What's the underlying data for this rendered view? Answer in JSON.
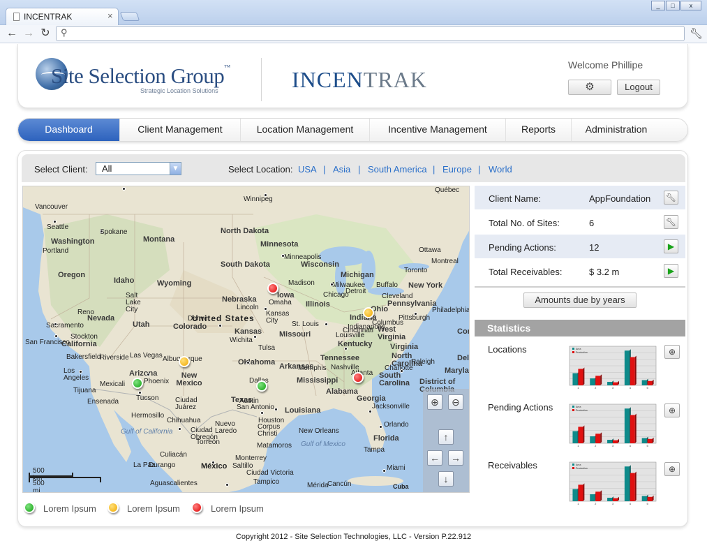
{
  "browser": {
    "tab_title": "INCENTRAK",
    "tab_close": "×",
    "address": "",
    "window_controls": [
      "_",
      "□",
      "x"
    ]
  },
  "header": {
    "brand_name": "Site Selection Group",
    "brand_tm": "™",
    "brand_tagline": "Strategic Location Solutions",
    "product_part1": "INCEN",
    "product_part2": "TRAK",
    "welcome": "Welcome Phillipe",
    "logout_label": "Logout",
    "settings_icon": "gear-icon"
  },
  "menu": {
    "items": [
      {
        "label": "Dashboard",
        "active": true
      },
      {
        "label": "Client Management"
      },
      {
        "label": "Location Management"
      },
      {
        "label": "Incentive Management"
      },
      {
        "label": "Reports"
      },
      {
        "label": "Administration"
      }
    ]
  },
  "filters": {
    "select_client_label": "Select Client:",
    "client_value": "All",
    "select_location_label": "Select Location:",
    "locations": [
      "USA",
      "Asia",
      "South America",
      "Europe",
      "World"
    ],
    "separator": "|"
  },
  "map": {
    "country_label": "United States",
    "scale_km": "500 km",
    "scale_mi": "500 mi",
    "credit": "Cuba",
    "states": [
      "Washington",
      "Oregon",
      "Idaho",
      "Montana",
      "North Dakota",
      "South Dakota",
      "Minnesota",
      "Wisconsin",
      "Michigan",
      "Wyoming",
      "Nevada",
      "Utah",
      "Colorado",
      "Nebraska",
      "Iowa",
      "Illinois",
      "Indiana",
      "Ohio",
      "Pennsylvania",
      "New York",
      "California",
      "Arizona",
      "New Mexico",
      "Texas",
      "Oklahoma",
      "Kansas",
      "Missouri",
      "Kentucky",
      "Tennessee",
      "Arkansas",
      "Mississippi",
      "Alabama",
      "Georgia",
      "Louisiana",
      "Florida",
      "Virginia",
      "West Virginia",
      "North Carolina",
      "South Carolina",
      "Maryland",
      "District of Columbia",
      "Conn",
      "Delaw"
    ],
    "cities": [
      "Vancouver",
      "Seattle",
      "Spokane",
      "Portland",
      "Winnipeg",
      "Minneapolis",
      "Salt Lake City",
      "Sacramento",
      "San Francisco",
      "Stockton",
      "Reno",
      "Bakersfield",
      "Los Angeles",
      "Las Vegas",
      "Riverside",
      "Mexicali",
      "Tijuana",
      "Ensenada",
      "Phoenix",
      "Tucson",
      "Albuquerque",
      "Denver",
      "Lincoln",
      "Omaha",
      "Kansas City",
      "Wichita",
      "Tulsa",
      "Dallas",
      "San Antonio",
      "Houston",
      "Austin",
      "Corpus Christi",
      "Monterrey",
      "Chihuahua",
      "Ciudad Juárez",
      "Hermosillo",
      "Culiacán",
      "La Paz",
      "Durango",
      "Torreón",
      "Saltillo",
      "Matamoros",
      "Nuevo Laredo",
      "Ciudad Obregón",
      "Ciudad Victoria",
      "Tampico",
      "Aguascalientes",
      "Mérida",
      "Cancún",
      "Chicago",
      "Madison",
      "Milwaukee",
      "Detroit",
      "Cleveland",
      "Toronto",
      "Buffalo",
      "Montreal",
      "Ottawa",
      "Québec",
      "Columbus",
      "Cincinnati",
      "Louisville",
      "Nashville",
      "Memphis",
      "Atlanta",
      "Jacksonville",
      "Orlando",
      "Miami",
      "Tampa",
      "Philadelphia",
      "New Orleans",
      "St. Louis",
      "Indianapolis",
      "Pittsburgh",
      "Charlotte",
      "Raleigh"
    ],
    "water": [
      "Gulf of California",
      "Gulf of Mexico"
    ],
    "country_mexico": "México",
    "markers": [
      {
        "color": "red",
        "place": "Iowa"
      },
      {
        "color": "yellow",
        "place": "Ohio"
      },
      {
        "color": "yellow",
        "place": "Albuquerque"
      },
      {
        "color": "green",
        "place": "Phoenix"
      },
      {
        "color": "green",
        "place": "Dallas"
      },
      {
        "color": "red",
        "place": "Atlanta"
      }
    ],
    "controls": [
      "zoom-in-icon",
      "zoom-out-icon",
      "arrow-up-icon",
      "arrow-left-icon",
      "arrow-right-icon",
      "arrow-down-icon"
    ]
  },
  "legend": [
    {
      "color": "green",
      "label": "Lorem Ipsum"
    },
    {
      "color": "yellow",
      "label": "Lorem Ipsum"
    },
    {
      "color": "red",
      "label": "Lorem Ipsum"
    }
  ],
  "client_info": {
    "rows": [
      {
        "label": "Client Name:",
        "value": "AppFoundation",
        "action": "wrench-icon"
      },
      {
        "label": "Total No. of Sites:",
        "value": "6",
        "action": "wrench-icon"
      },
      {
        "label": "Pending Actions:",
        "value": "12",
        "action": "play-icon"
      },
      {
        "label": "Total Receivables:",
        "value": "$ 3.2 m",
        "action": "play-icon"
      }
    ],
    "amounts_button": "Amounts due by years"
  },
  "statistics": {
    "title": "Statistics",
    "charts": [
      {
        "label": "Locations"
      },
      {
        "label": "Pending Actions"
      },
      {
        "label": "Receivables"
      }
    ],
    "chart_data": {
      "type": "bar",
      "categories": [
        "1",
        "2",
        "3",
        "4",
        "5"
      ],
      "series": [
        {
          "name": "Area",
          "values": [
            28,
            16,
            8,
            80,
            12
          ]
        },
        {
          "name": "Production",
          "values": [
            38,
            22,
            7,
            65,
            10
          ]
        }
      ],
      "ylim": [
        0,
        90
      ]
    }
  },
  "footer": {
    "copyright": "Copyright 2012 - Site Selection Technologies, LLC - Version P.22.912"
  }
}
